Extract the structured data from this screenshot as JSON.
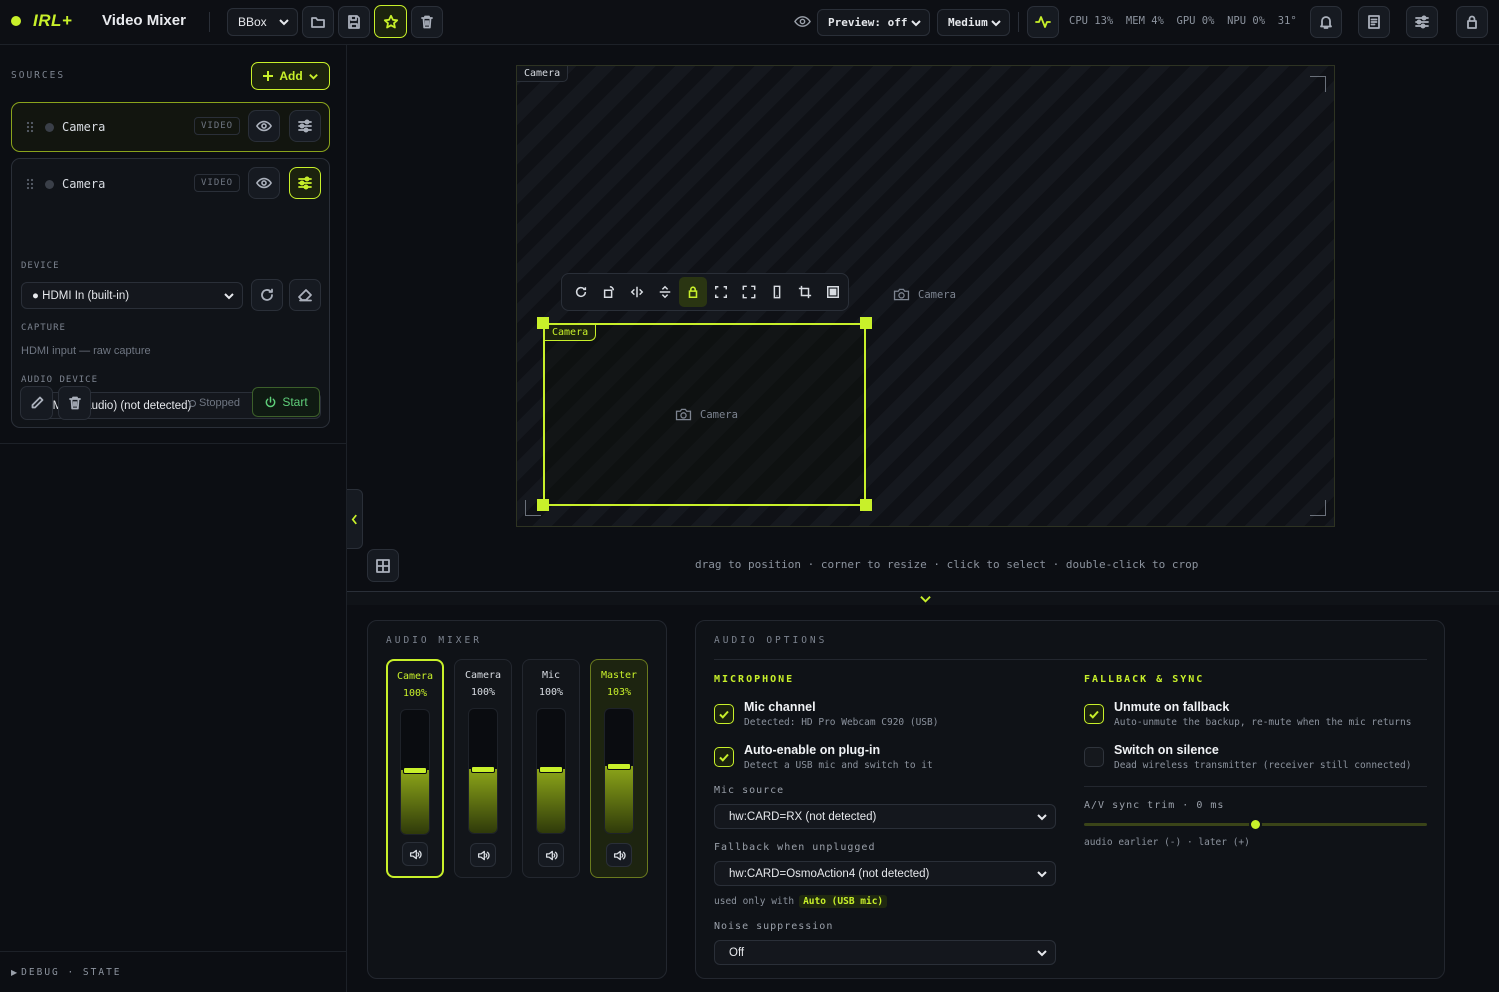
{
  "app": {
    "brand": "IRL+",
    "title": "Video Mixer"
  },
  "toolbar": {
    "scene_select": "BBox",
    "preview_select": "Preview: off",
    "quality_select": "Medium",
    "stats": {
      "cpu": "CPU 13%",
      "mem": "MEM 4%",
      "gpu": "GPU 0%",
      "npu": "NPU 0%",
      "temp": "31°"
    }
  },
  "sources": {
    "header": "SOURCES",
    "add_label": "Add",
    "items": [
      {
        "name": "Camera",
        "type": "VIDEO"
      },
      {
        "name": "Camera",
        "type": "VIDEO"
      }
    ],
    "expanded": {
      "device_label": "DEVICE",
      "device_value": "● HDMI In (built-in)",
      "capture_label": "CAPTURE",
      "capture_value": "HDMI input — raw capture",
      "audio_device_label": "AUDIO DEVICE",
      "audio_device_value": "HDMI In (audio) (not detected)",
      "status": "Stopped",
      "start_label": "Start"
    },
    "debug_label": "DEBUG · STATE"
  },
  "canvas": {
    "outer_label": "Camera",
    "inner_label": "Camera",
    "placeholder_main": "Camera",
    "placeholder_inner": "Camera",
    "hint": "drag to position · corner to resize · click to select · double-click to crop"
  },
  "audio_mixer": {
    "title": "AUDIO MIXER",
    "channels": [
      {
        "name": "Camera",
        "level": "100%",
        "fill": 0.52
      },
      {
        "name": "Camera",
        "level": "100%",
        "fill": 0.52
      },
      {
        "name": "Mic",
        "level": "100%",
        "fill": 0.52
      },
      {
        "name": "Master",
        "level": "103%",
        "fill": 0.54
      }
    ]
  },
  "audio_options": {
    "title": "AUDIO OPTIONS",
    "microphone_header": "MICROPHONE",
    "mic_channel": {
      "title": "Mic channel",
      "desc": "Detected: HD Pro Webcam C920 (USB)",
      "checked": true
    },
    "auto_enable": {
      "title": "Auto-enable on plug-in",
      "desc": "Detect a USB mic and switch to it",
      "checked": true
    },
    "mic_source_label": "Mic source",
    "mic_source_value": "hw:CARD=RX (not detected)",
    "fallback_label": "Fallback when unplugged",
    "fallback_value": "hw:CARD=OsmoAction4 (not detected)",
    "used_only_with": "used only with",
    "used_only_badge": "Auto (USB mic)",
    "noise_label": "Noise suppression",
    "noise_value": "Off",
    "fallback_header": "FALLBACK & SYNC",
    "unmute_fallback": {
      "title": "Unmute on fallback",
      "desc": "Auto-unmute the backup, re-mute when the mic returns",
      "checked": true
    },
    "switch_silence": {
      "title": "Switch on silence",
      "desc": "Dead wireless transmitter (receiver still connected)",
      "checked": false
    },
    "av_sync_label": "A/V sync trim · 0 ms",
    "av_sync_value": 0,
    "av_sync_hint": "audio earlier (-) · later (+)"
  },
  "colors": {
    "accent": "#c8f02a",
    "background": "#0c0e13",
    "panel": "#0f1217"
  }
}
